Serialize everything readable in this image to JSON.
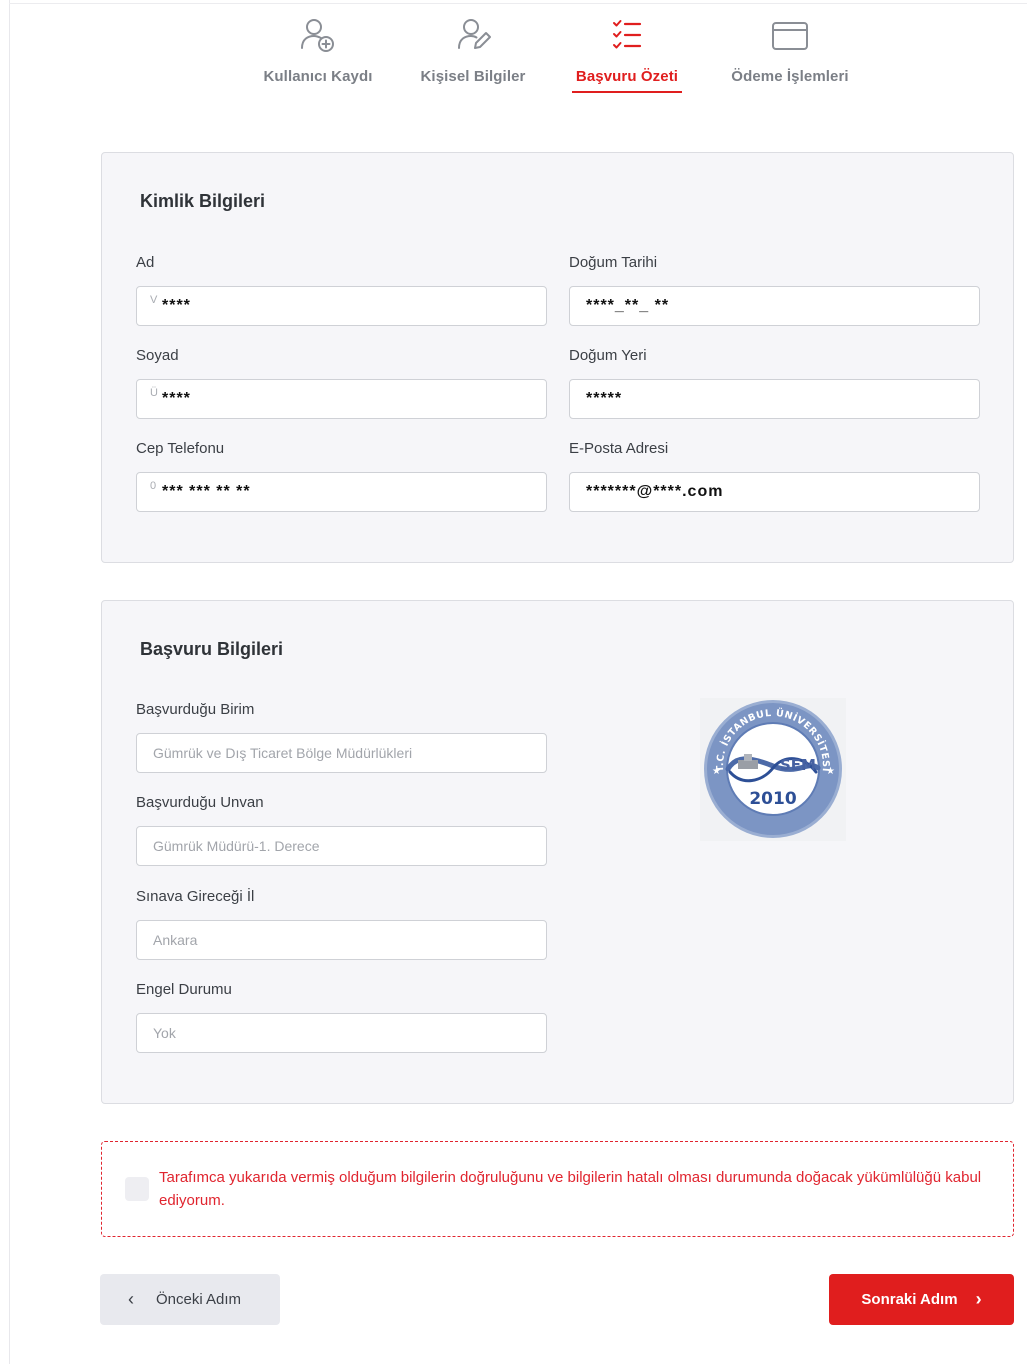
{
  "stepper": {
    "steps": [
      {
        "label": "Kullanıcı Kaydı",
        "icon": "user-add-icon"
      },
      {
        "label": "Kişisel Bilgiler",
        "icon": "user-edit-icon"
      },
      {
        "label": "Başvuru Özeti",
        "icon": "checklist-icon"
      },
      {
        "label": "Ödeme İşlemleri",
        "icon": "credit-card-icon"
      }
    ],
    "active_index": 2
  },
  "identity": {
    "title": "Kimlik Bilgileri",
    "ad": {
      "label": "Ad",
      "hint": "V",
      "value": "****"
    },
    "dogum_tarihi": {
      "label": "Doğum Tarihi",
      "value": "****_**_ **"
    },
    "soyad": {
      "label": "Soyad",
      "hint": "Ü",
      "value": "****"
    },
    "dogum_yeri": {
      "label": "Doğum Yeri",
      "value": "*****"
    },
    "cep_telefonu": {
      "label": "Cep Telefonu",
      "hint": "0",
      "value": "*** *** ** **"
    },
    "eposta": {
      "label": "E-Posta Adresi",
      "value": "*******@****.com"
    }
  },
  "application": {
    "title": "Başvuru Bilgileri",
    "birim": {
      "label": "Başvurduğu Birim",
      "value": "Gümrük ve Dış Ticaret Bölge Müdürlükleri"
    },
    "unvan": {
      "label": "Başvurduğu Unvan",
      "value": "Gümrük Müdürü-1. Derece"
    },
    "il": {
      "label": "Sınava Gireceği İl",
      "value": "Ankara"
    },
    "engel": {
      "label": "Engel Durumu",
      "value": "Yok"
    },
    "emblem": {
      "ring_text": "T.C. İSTANBUL ÜNİVERSİTESİ",
      "name": "SEM",
      "year": "2010"
    }
  },
  "consent": {
    "text": "Tarafımca yukarıda vermiş olduğum bilgilerin doğruluğunu ve bilgilerin hatalı olması durumunda doğacak yükümlülüğü kabul ediyorum.",
    "checked": false
  },
  "nav": {
    "prev_label": "Önceki Adım",
    "next_label": "Sonraki Adım"
  },
  "colors": {
    "accent": "#e01e1e",
    "inactive": "#7b7f86",
    "card_bg": "#f6f6f9"
  }
}
